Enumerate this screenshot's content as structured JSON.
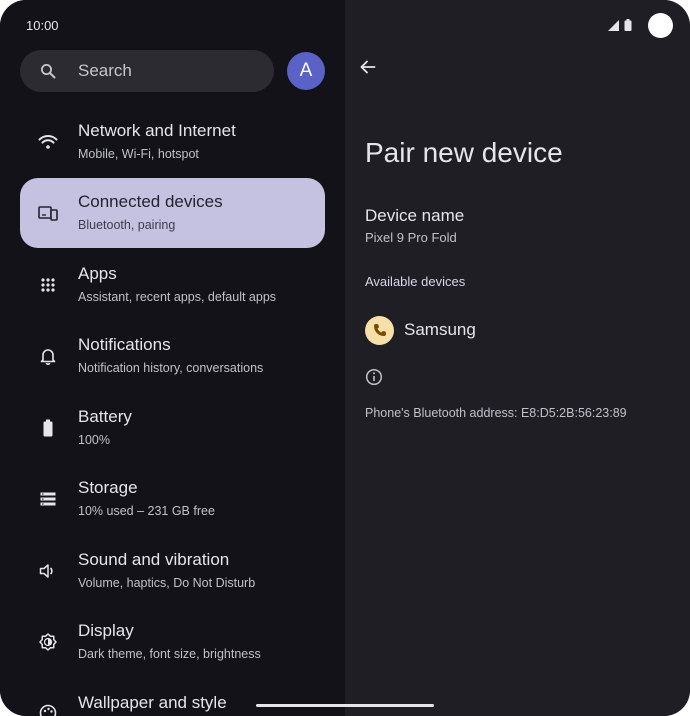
{
  "status_bar": {
    "time": "10:00"
  },
  "search": {
    "label": "Search"
  },
  "account": {
    "avatar_letter": "A"
  },
  "settings_menu": [
    {
      "title": "Network and Internet",
      "subtitle": "Mobile, Wi-Fi, hotspot",
      "icon": "wifi-icon",
      "selected": false
    },
    {
      "title": "Connected devices",
      "subtitle": "Bluetooth, pairing",
      "icon": "connected-devices-icon",
      "selected": true
    },
    {
      "title": "Apps",
      "subtitle": "Assistant, recent apps, default apps",
      "icon": "apps-grid-icon",
      "selected": false
    },
    {
      "title": "Notifications",
      "subtitle": "Notification history, conversations",
      "icon": "bell-icon",
      "selected": false
    },
    {
      "title": "Battery",
      "subtitle": "100%",
      "icon": "battery-icon",
      "selected": false
    },
    {
      "title": "Storage",
      "subtitle": "10% used – 231 GB free",
      "icon": "storage-icon",
      "selected": false
    },
    {
      "title": "Sound and vibration",
      "subtitle": "Volume, haptics, Do Not Disturb",
      "icon": "speaker-icon",
      "selected": false
    },
    {
      "title": "Display",
      "subtitle": "Dark theme, font size, brightness",
      "icon": "display-brightness-icon",
      "selected": false
    },
    {
      "title": "Wallpaper and style",
      "subtitle": "",
      "icon": "palette-icon",
      "selected": false
    }
  ],
  "detail": {
    "title": "Pair new device",
    "device_name_label": "Device name",
    "device_name_value": "Pixel 9 Pro Fold",
    "available_header": "Available devices",
    "available_devices": [
      {
        "name": "Samsung",
        "icon": "phone-icon"
      }
    ],
    "bt_address_text": "Phone's Bluetooth address: E8:D5:2B:56:23:89"
  },
  "colors": {
    "left_background": "#121218",
    "right_background": "#1e1e24",
    "selected_item": "#c5c1e0",
    "avatar": "#5a61c7",
    "device_icon_bg": "#f6dfa9"
  }
}
